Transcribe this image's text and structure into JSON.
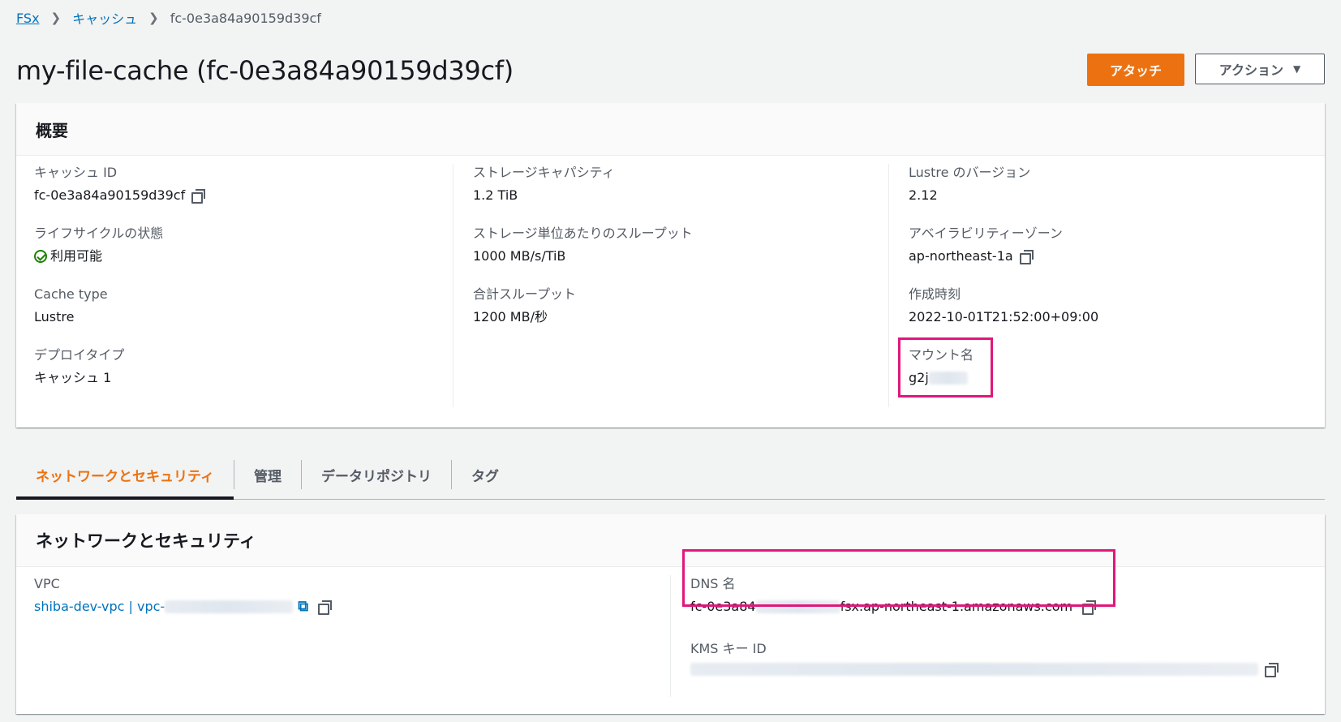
{
  "breadcrumb": {
    "root": "FSx",
    "section": "キャッシュ",
    "current": "fc-0e3a84a90159d39cf"
  },
  "page": {
    "title": "my-file-cache (fc-0e3a84a90159d39cf)"
  },
  "actions": {
    "attach": "アタッチ",
    "actions": "アクション"
  },
  "summary": {
    "header": "概要",
    "cache_id": {
      "label": "キャッシュ ID",
      "value": "fc-0e3a84a90159d39cf"
    },
    "lifecycle": {
      "label": "ライフサイクルの状態",
      "value": "利用可能"
    },
    "cache_type": {
      "label": "Cache type",
      "value": "Lustre"
    },
    "deploy_type": {
      "label": "デプロイタイプ",
      "value": "キャッシュ 1"
    },
    "storage_capacity": {
      "label": "ストレージキャパシティ",
      "value": "1.2 TiB"
    },
    "throughput_per_unit": {
      "label": "ストレージ単位あたりのスループット",
      "value": "1000 MB/s/TiB"
    },
    "total_throughput": {
      "label": "合計スループット",
      "value": "1200 MB/秒"
    },
    "lustre_version": {
      "label": "Lustre のバージョン",
      "value": "2.12"
    },
    "az": {
      "label": "アベイラビリティーゾーン",
      "value": "ap-northeast-1a"
    },
    "created": {
      "label": "作成時刻",
      "value": "2022-10-01T21:52:00+09:00"
    },
    "mount_name": {
      "label": "マウント名",
      "value": "g2j"
    }
  },
  "tabs": [
    "ネットワークとセキュリティ",
    "管理",
    "データリポジトリ",
    "タグ"
  ],
  "network": {
    "header": "ネットワークとセキュリティ",
    "vpc": {
      "label": "VPC",
      "value": "shiba-dev-vpc | vpc-"
    },
    "dns": {
      "label": "DNS 名",
      "prefix": "fc-0e3a84",
      "suffix": "fsx.ap-northeast-1.amazonaws.com"
    },
    "kms": {
      "label": "KMS キー ID"
    }
  },
  "colors": {
    "accent": "#ec7211",
    "link": "#0073bb",
    "highlight": "#e0187a",
    "success": "#1d8102"
  }
}
